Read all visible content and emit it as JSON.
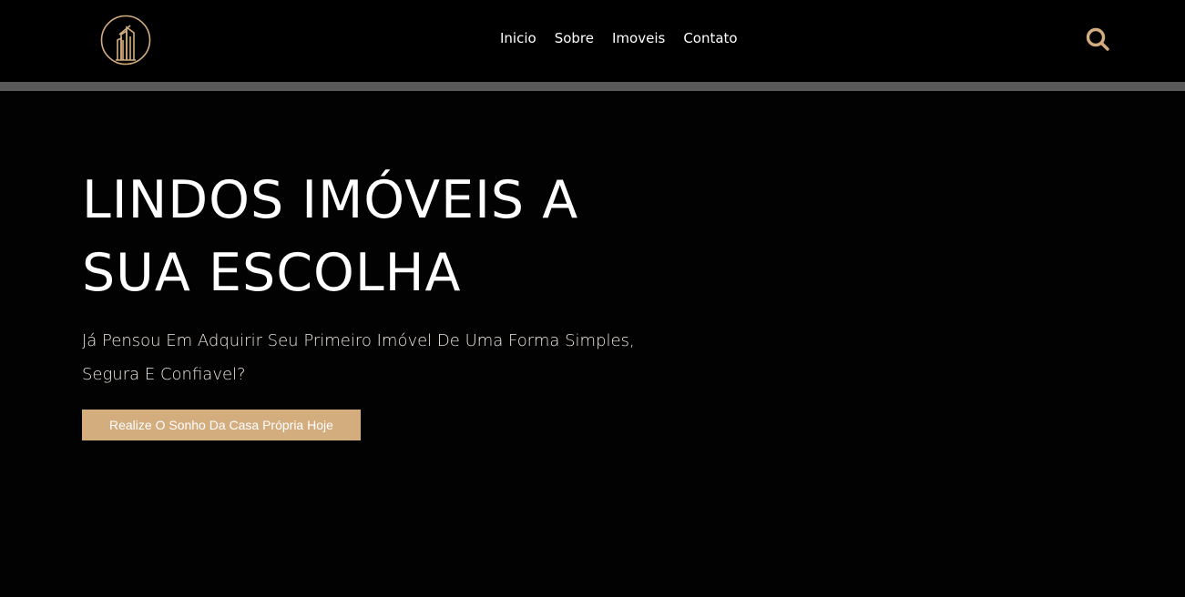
{
  "header": {
    "logo_icon": "building-logo-icon",
    "nav": [
      {
        "label": "Inicio"
      },
      {
        "label": "Sobre"
      },
      {
        "label": "Imoveis"
      },
      {
        "label": "Contato"
      }
    ],
    "search_icon": "search-icon"
  },
  "hero": {
    "title_line1": "LINDOS IMÓVEIS A",
    "title_line2": "SUA ESCOLHA",
    "subtitle": "Já Pensou Em Adquirir Seu Primeiro Imóvel De Uma Forma Simples, Segura E Confiavel?",
    "cta_label": "Realize O Sonho Da Casa Própria Hoje"
  },
  "colors": {
    "background": "#020203",
    "accent": "#d4ad7f",
    "divider": "#5a5a5a"
  }
}
